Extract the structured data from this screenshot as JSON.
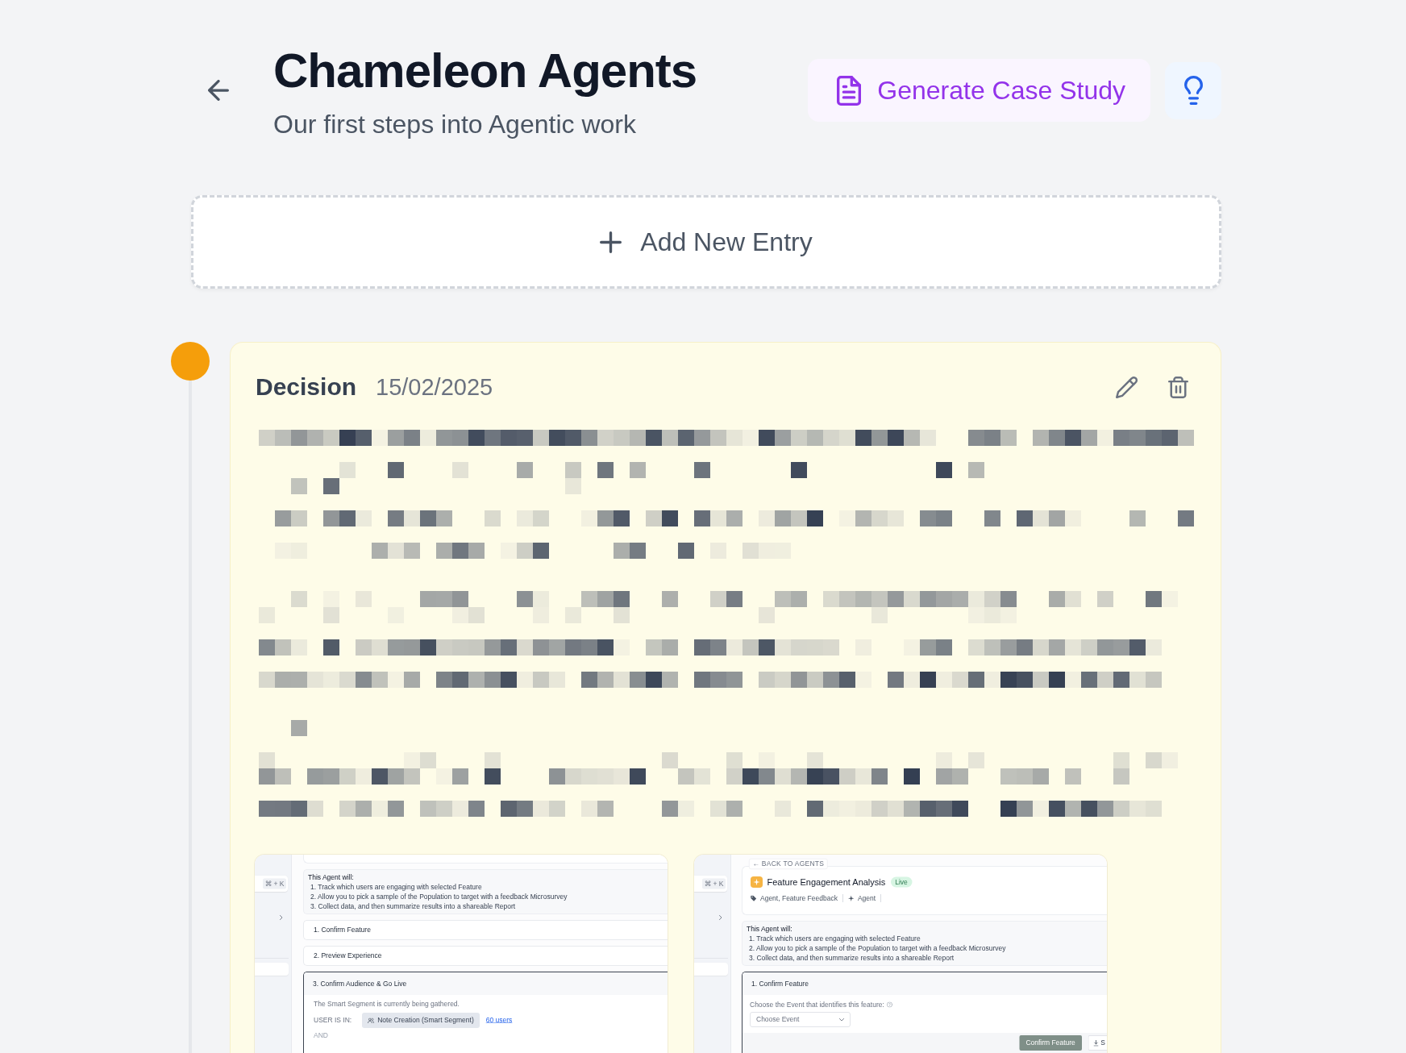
{
  "header": {
    "title": "Chameleon Agents",
    "subtitle": "Our first steps into Agentic work",
    "generate_button": {
      "label": "Generate Case Study"
    }
  },
  "add_entry": {
    "label": "Add New Entry"
  },
  "entries": [
    {
      "type": "Decision",
      "date": "15/02/2025",
      "color": "#f59e0b",
      "screenshots": [
        {
          "sidebar": {
            "shortcut": "⌘ + K"
          },
          "intro": {
            "heading": "This Agent will:",
            "items": [
              "1. Track which users are engaging with selected Feature",
              "2. Allow you to pick a sample of the Population to target with a feedback Microsurvey",
              "3. Collect data, and then summarize results into a shareable Report"
            ]
          },
          "steps": [
            {
              "title": "1. Confirm Feature",
              "expanded": false
            },
            {
              "title": "2. Preview Experience",
              "expanded": false
            },
            {
              "title": "3. Confirm Audience & Go Live",
              "expanded": true,
              "body": {
                "kind": "audience",
                "note": "The Smart Segment is currently being gathered.",
                "label": "USER IS IN:",
                "segment": "Note Creation (Smart Segment)",
                "link": "60 users",
                "joiner": "AND"
              }
            }
          ]
        },
        {
          "sidebar": {
            "shortcut": "⌘ + K"
          },
          "back_link": "← BACK TO AGENTS",
          "agent": {
            "name": "Feature Engagement Analysis",
            "status": "Live",
            "tags": "Agent, Feature Feedback",
            "type": "Agent"
          },
          "intro": {
            "heading": "This Agent will:",
            "items": [
              "1. Track which users are engaging with selected Feature",
              "2. Allow you to pick a sample of the Population to target with a feedback Microsurvey",
              "3. Collect data, and then summarize results into a shareable Report"
            ]
          },
          "steps": [
            {
              "title": "1. Confirm Feature",
              "expanded": true,
              "body": {
                "kind": "event",
                "label": "Choose the Event that identifies this feature:",
                "placeholder": "Choose Event",
                "buttons": [
                  {
                    "kind": "primary",
                    "label": "Confirm Feature"
                  },
                  {
                    "kind": "download",
                    "label": "S"
                  }
                ]
              }
            }
          ]
        }
      ]
    }
  ]
}
